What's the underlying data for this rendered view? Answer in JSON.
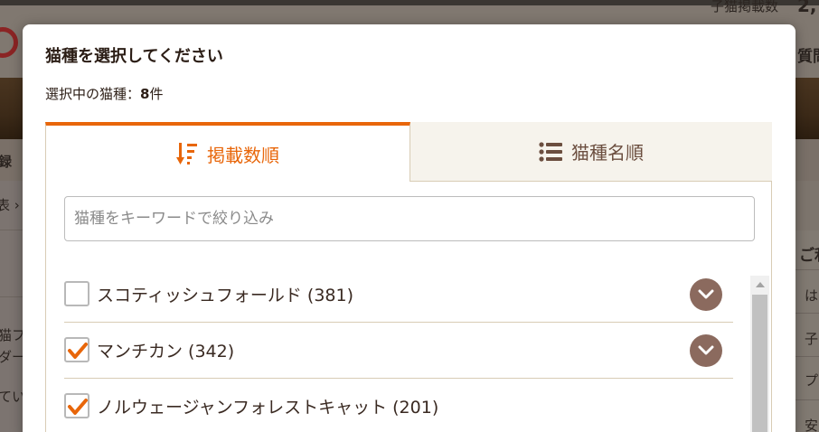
{
  "background": {
    "header_right": "子猫掲載数",
    "header_right_num": "2,",
    "nav_right": "質問",
    "left_labels": [
      "録",
      "表 ›",
      "猫フ",
      "ダー",
      "てい"
    ],
    "right_labels": [
      "ご利",
      "は",
      "子",
      "プ",
      "安"
    ]
  },
  "modal": {
    "title": "猫種を選択してください",
    "selected_label": "選択中の猫種：",
    "selected_count": "8",
    "selected_unit": "件",
    "tabs": [
      {
        "label": "掲載数順",
        "icon": "sort-descending-icon",
        "active": true
      },
      {
        "label": "猫種名順",
        "icon": "list-icon",
        "active": false
      }
    ],
    "search": {
      "value": "",
      "placeholder": "猫種をキーワードで絞り込み"
    },
    "items": [
      {
        "label": "スコティッシュフォールド (381)",
        "checked": false
      },
      {
        "label": "マンチカン (342)",
        "checked": true
      },
      {
        "label": "ノルウェージャンフォレストキャット (201)",
        "checked": true
      }
    ]
  },
  "colors": {
    "accent": "#e8660a",
    "brown": "#8b6a5e",
    "tab_inactive_text": "#6b4e3f",
    "divider": "#d8ccb5"
  }
}
